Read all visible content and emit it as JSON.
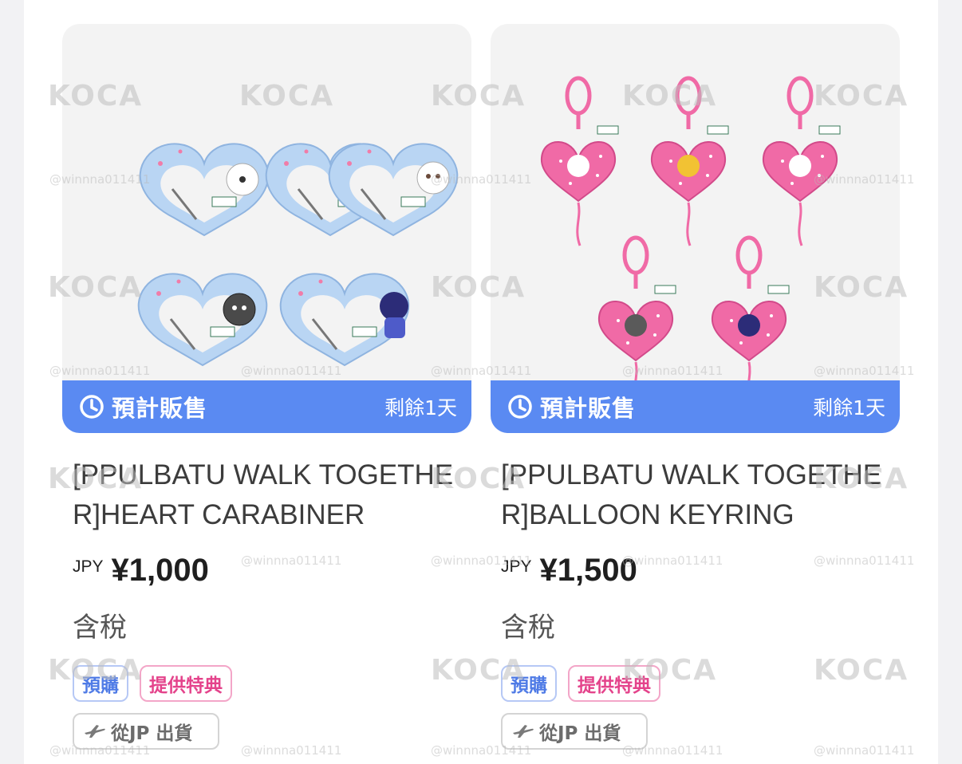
{
  "products": [
    {
      "sale_status": "預計販售",
      "remaining": "剩餘1天",
      "title": "[PPULBATU WALK TOGETHER]HEART CARABINER",
      "currency": "JPY",
      "price": "¥1,000",
      "tax_note": "含稅",
      "tags": [
        "預購",
        "提供特典"
      ],
      "shipping": "從JP 出貨",
      "image_icon": "heart-carabiner-product-image"
    },
    {
      "sale_status": "預計販售",
      "remaining": "剩餘1天",
      "title": "[PPULBATU WALK TOGETHER]BALLOON KEYRING",
      "currency": "JPY",
      "price": "¥1,500",
      "tax_note": "含稅",
      "tags": [
        "預購",
        "提供特典"
      ],
      "shipping": "從JP 出貨",
      "image_icon": "balloon-keyring-product-image"
    }
  ],
  "watermark": {
    "logo": "KOCA",
    "handle": "@winnna011411"
  },
  "colors": {
    "sale_bar": "#5a8af2",
    "tag_preorder": "#4f7be6",
    "tag_bonus": "#e4438b",
    "heart_blue": "#b7d3f2",
    "heart_pink": "#f06aa6"
  }
}
